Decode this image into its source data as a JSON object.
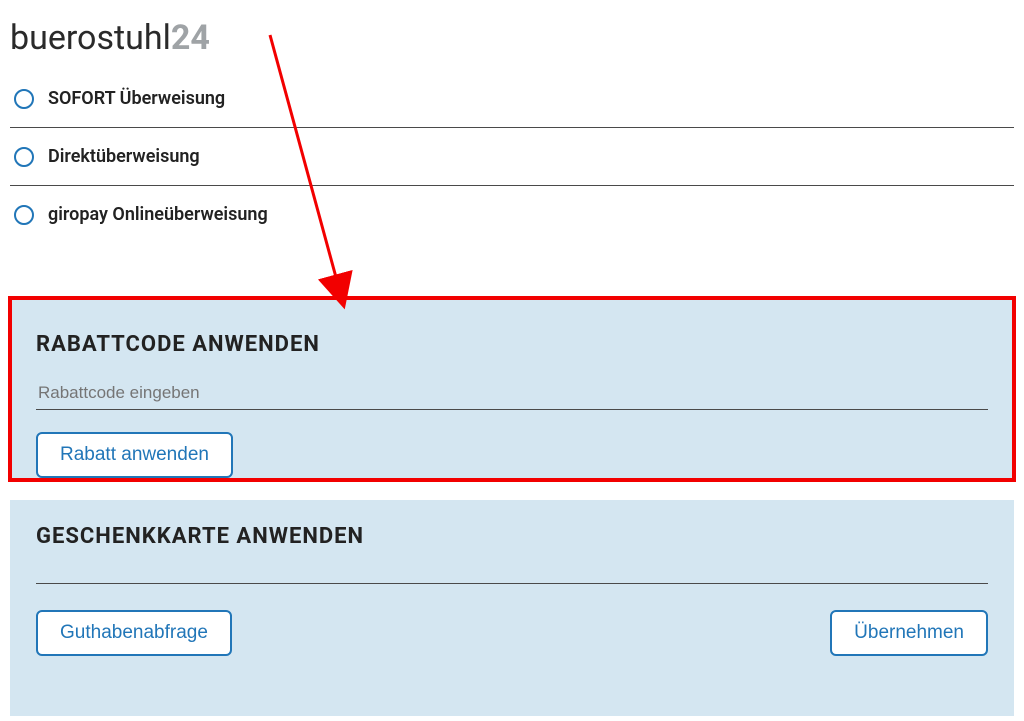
{
  "logo": {
    "part1": "buerostuhl",
    "part2": "24"
  },
  "payment": {
    "options": [
      {
        "label": "SOFORT Überweisung"
      },
      {
        "label": "Direktüberweisung"
      },
      {
        "label": "giropay Onlineüberweisung"
      }
    ]
  },
  "rabatt": {
    "title": "RABATTCODE ANWENDEN",
    "placeholder": "Rabattcode eingeben",
    "apply_label": "Rabatt anwenden"
  },
  "gift": {
    "title": "GESCHENKKARTE ANWENDEN",
    "balance_label": "Guthabenabfrage",
    "apply_label": "Übernehmen"
  },
  "colors": {
    "accent": "#2176b8",
    "panel_bg": "#d4e6f1",
    "highlight": "#f20000"
  }
}
